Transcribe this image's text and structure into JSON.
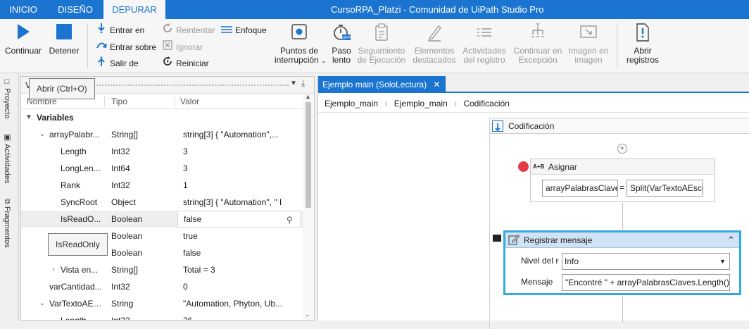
{
  "menu_tabs": [
    "INICIO",
    "DISEÑO",
    "DEPURAR"
  ],
  "app_title": "CursoRPA_Platzi - Comunidad de UiPath Studio Pro",
  "ribbon": {
    "continuar": "Continuar",
    "detener": "Detener",
    "entrar_en": "Entrar en",
    "entrar_sobre": "Entrar sobre",
    "salir_de": "Salir de",
    "reintentar": "Reintentar",
    "ignorar": "Ignorar",
    "reiniciar": "Reiniciar",
    "enfoque": "Enfoque",
    "puntos_line1": "Puntos de",
    "puntos_line2": "interrupción",
    "paso_line1": "Paso",
    "paso_line2": "lento",
    "seguimiento_line1": "Seguimiento",
    "seguimiento_line2": "de Ejecución",
    "elementos_line1": "Elementos",
    "elementos_line2": "destacados",
    "actividades_line1": "Actividades",
    "actividades_line2": "del registro",
    "continuar_exc_line1": "Continuar en",
    "continuar_exc_line2": "Excepción",
    "imagen_line1": "Imagen en",
    "imagen_line2": "imagen",
    "abrir_line1": "Abrir",
    "abrir_line2": "registros"
  },
  "side_tabs": [
    "Proyecto",
    "Actividades",
    "Fragmentos"
  ],
  "panel": {
    "title_letter": "V",
    "tooltip_open": "Abrir (Ctrl+O)",
    "tooltip_readonly": "IsReadOnly",
    "columns": [
      "Nombre",
      "Tipo",
      "Valor"
    ],
    "rows": [
      {
        "name": "Variables",
        "type": "",
        "value": ""
      },
      {
        "name": "arrayPalabr...",
        "type": "String[]",
        "value": "string[3] { \"Automation\",..."
      },
      {
        "name": "Length",
        "type": "Int32",
        "value": "3"
      },
      {
        "name": "LongLen...",
        "type": "Int64",
        "value": "3"
      },
      {
        "name": "Rank",
        "type": "Int32",
        "value": "1"
      },
      {
        "name": "SyncRoot",
        "type": "Object",
        "value": "string[3] { \"Automation\", \" I"
      },
      {
        "name": "IsReadO...",
        "type": "Boolean",
        "value": "false"
      },
      {
        "name": "",
        "type": "Boolean",
        "value": "true"
      },
      {
        "name": "",
        "type": "Boolean",
        "value": "false"
      },
      {
        "name": "Vista en...",
        "type": "String[]",
        "value": "Total = 3"
      },
      {
        "name": "varCantidad...",
        "type": "Int32",
        "value": "0"
      },
      {
        "name": "VarTextoAEs...",
        "type": "String",
        "value": "\"Automation, Phyton, Ub..."
      },
      {
        "name": "Length",
        "type": "Int32",
        "value": "26"
      }
    ]
  },
  "document": {
    "tab_label": "Ejemplo main (SoloLectura)",
    "breadcrumb": [
      "Ejemplo_main",
      "Ejemplo_main",
      "Codificación"
    ],
    "sequence_title": "Codificación",
    "assign": {
      "title": "Asignar",
      "icon_text": "A+B",
      "left": "arrayPalabrasClave",
      "equals": "=",
      "right": "Split(VarTextoAEsci"
    },
    "log": {
      "title": "Registrar mensaje",
      "level_label": "Nivel del r",
      "level_value": "Info",
      "message_label": "Mensaje",
      "message_value": "\"Encontré \" + arrayPalabrasClaves.Length()"
    }
  }
}
